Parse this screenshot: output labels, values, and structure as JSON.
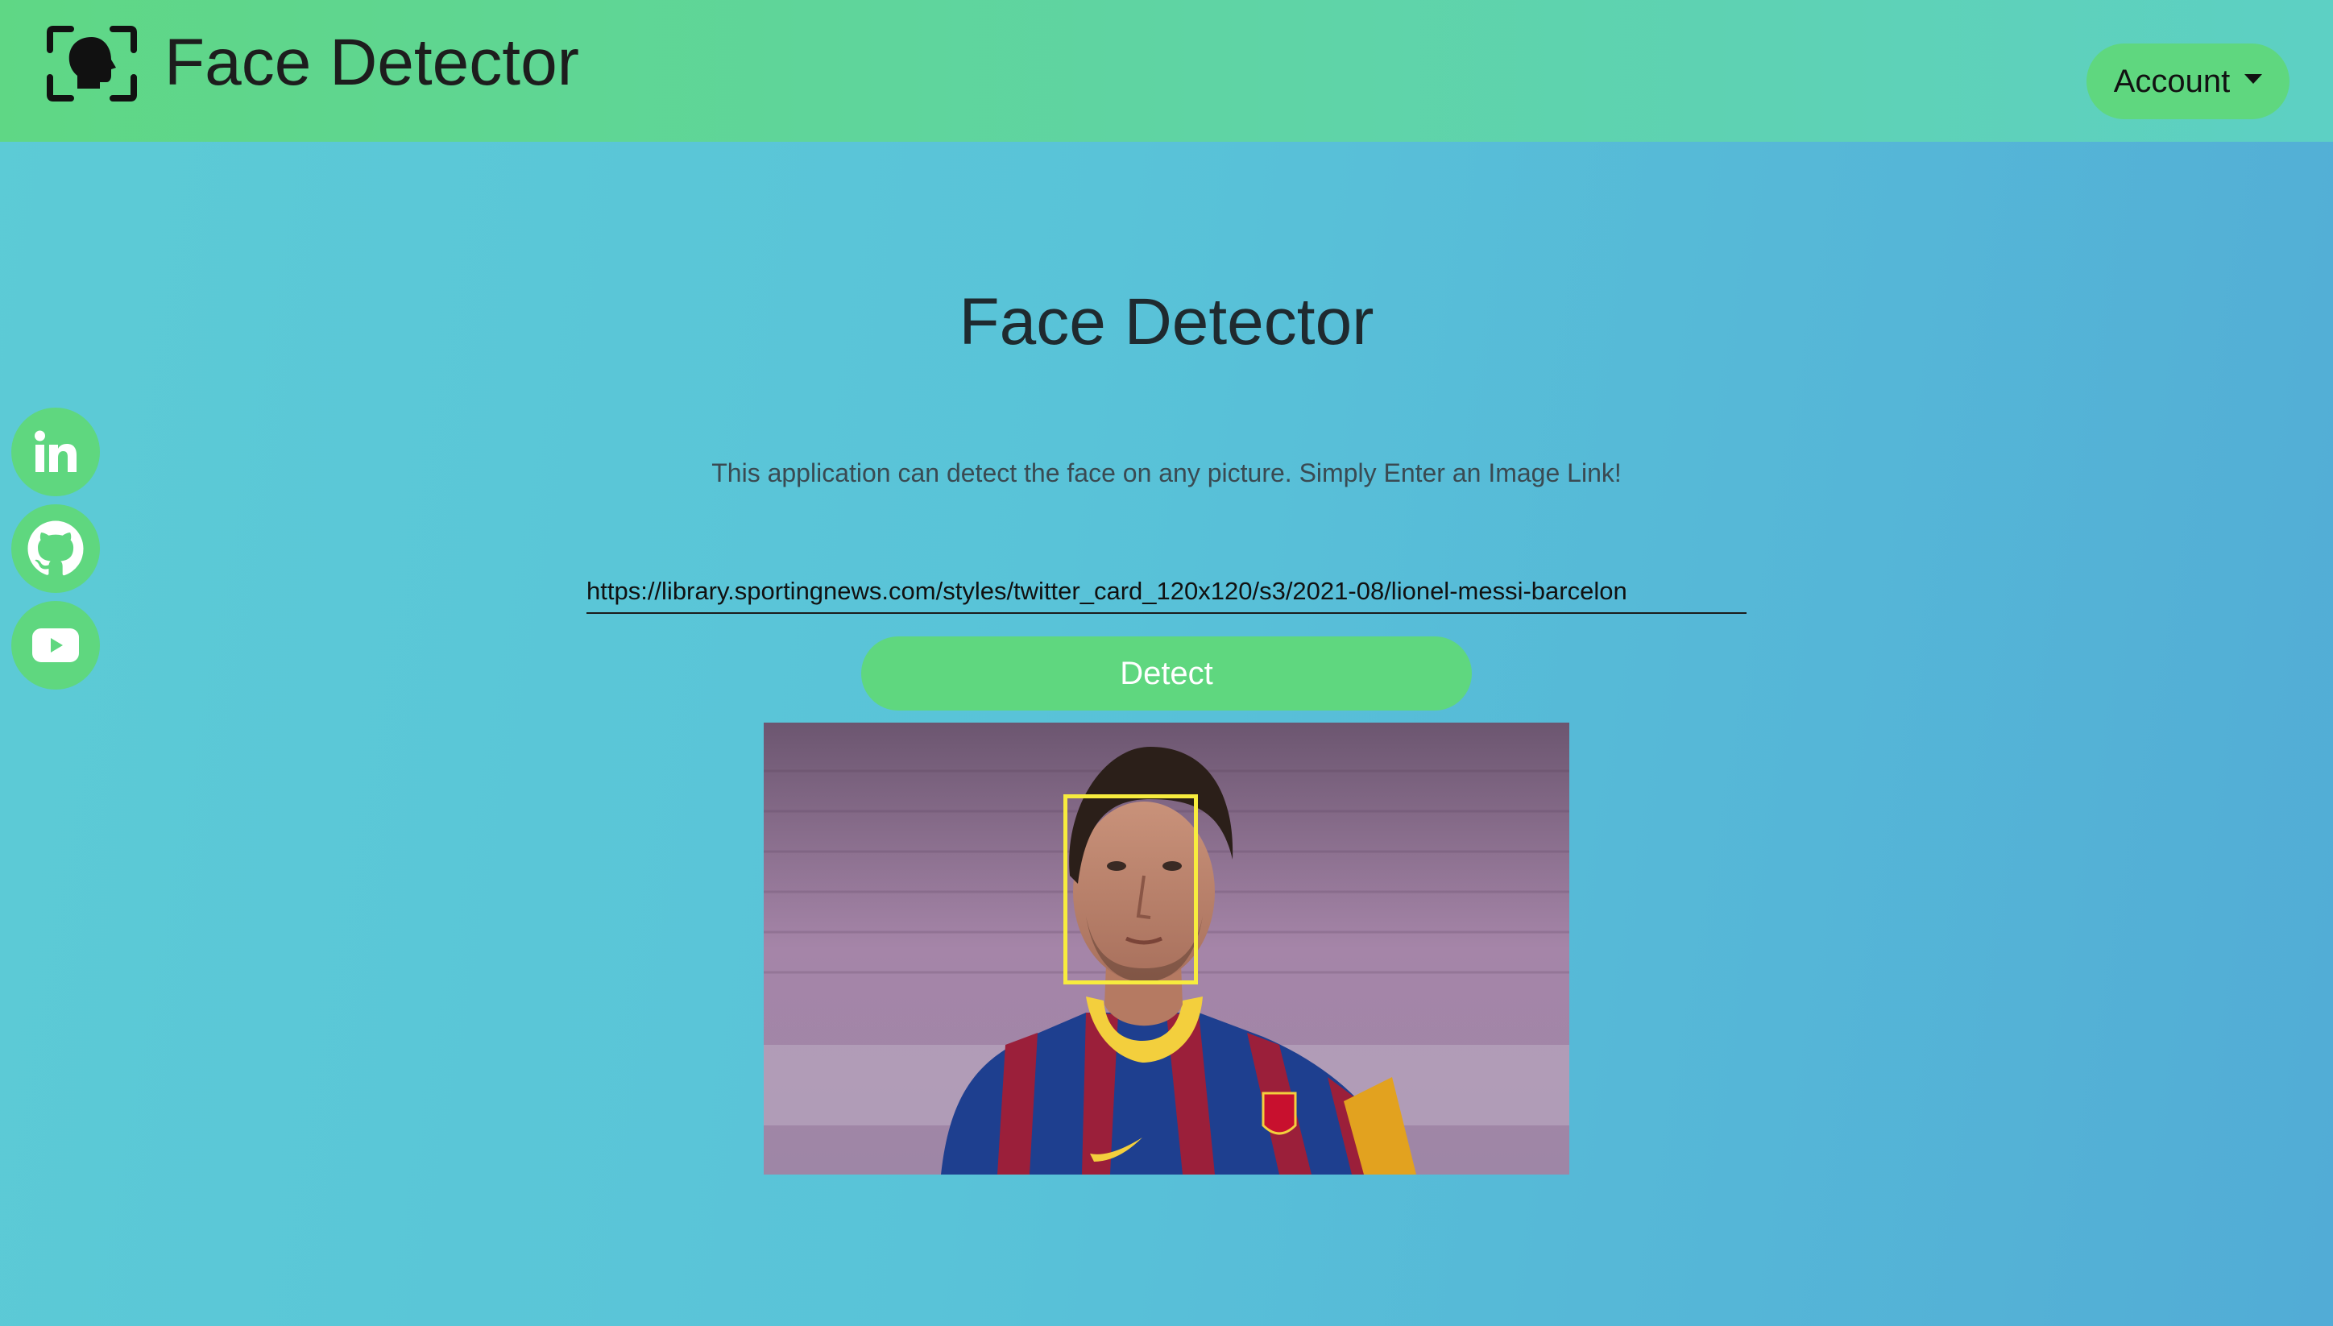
{
  "header": {
    "title": "Face Detector",
    "account_label": "Account"
  },
  "sidebar": {
    "social_links": [
      {
        "name": "LinkedIn",
        "icon": "linkedin-icon"
      },
      {
        "name": "GitHub",
        "icon": "github-icon"
      },
      {
        "name": "YouTube",
        "icon": "youtube-icon"
      }
    ]
  },
  "main": {
    "title": "Face Detector",
    "subtitle": "This application can detect the face on any picture. Simply Enter an Image Link!",
    "url_value": "https://library.sportingnews.com/styles/twitter_card_120x120/s3/2021-08/lionel-messi-barcelon",
    "detect_label": "Detect"
  },
  "colors": {
    "header_gradient_start": "#5fd785",
    "header_gradient_end": "#5dd0c4",
    "background_start": "#5ccbd6",
    "background_end": "#52acd6",
    "accent_green": "#5fd77f",
    "face_box": "#f7ec3e"
  }
}
